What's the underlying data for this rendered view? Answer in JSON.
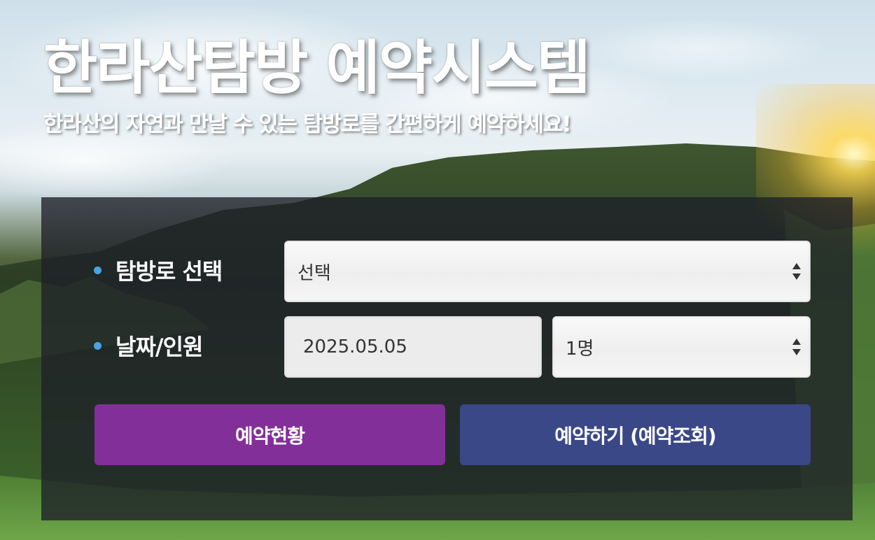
{
  "header": {
    "title": "한라산탐방 예약시스템",
    "subtitle": "한라산의 자연과 만날 수 있는 탐방로를 간편하게 예약하세요!"
  },
  "form": {
    "trail_label": "탐방로 선택",
    "trail_select_value": "선택",
    "date_people_label": "날짜/인원",
    "date_value": "2025.05.05",
    "people_select_value": "1명"
  },
  "buttons": {
    "status_label": "예약현황",
    "reserve_label": "예약하기 (예약조회)"
  },
  "colors": {
    "status_button": "#822f9a",
    "reserve_button": "#3a4888",
    "bullet": "#4aa3e0"
  },
  "icons": {
    "select_arrows": "updown-arrows-icon",
    "bullet": "bullet-dot-icon"
  }
}
